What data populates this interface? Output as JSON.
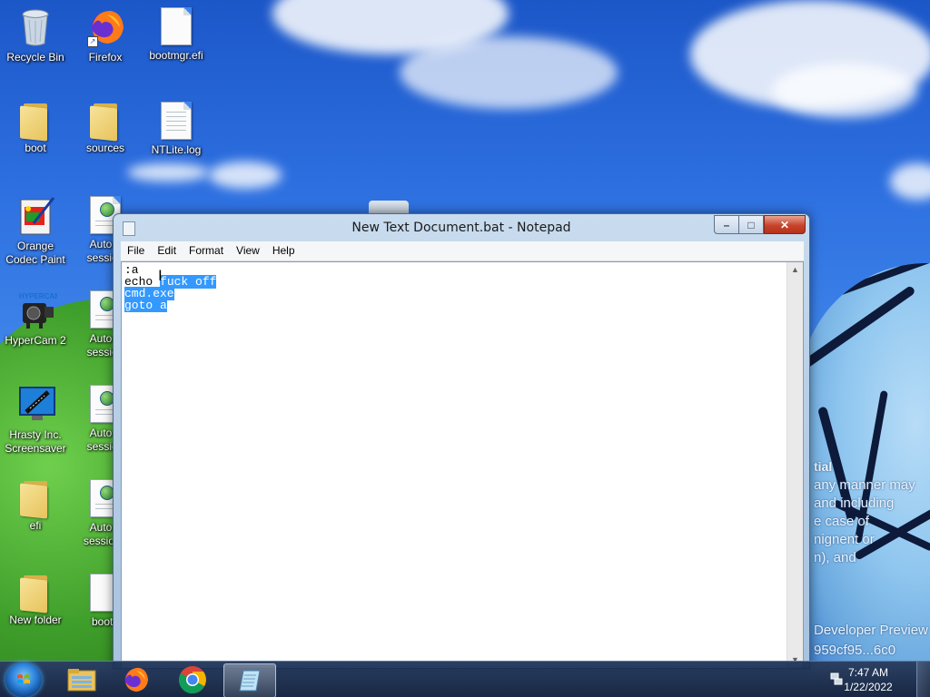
{
  "desktop": {
    "icons": [
      {
        "label": "Recycle Bin",
        "icon": "recycle-bin-icon"
      },
      {
        "label": "Firefox",
        "icon": "firefox-icon"
      },
      {
        "label": "bootmgr.efi",
        "icon": "file-icon"
      },
      {
        "label": "boot",
        "icon": "folder-icon"
      },
      {
        "label": "sources",
        "icon": "folder-icon"
      },
      {
        "label": "NTLite.log",
        "icon": "text-file-icon"
      },
      {
        "label": "Orange\nCodec Paint",
        "icon": "orange-codec-paint-icon"
      },
      {
        "label": "Auto-s\nsession",
        "icon": "session-file-icon"
      },
      {
        "label": "HyperCam 2",
        "icon": "hypercam-icon"
      },
      {
        "label": "Auto-s\nsession",
        "icon": "session-file-icon"
      },
      {
        "label": "Hrasty Inc.\nScreensaver",
        "icon": "screensaver-icon"
      },
      {
        "label": "Auto-s\nsession",
        "icon": "session-file-icon"
      },
      {
        "label": "efi",
        "icon": "folder-icon"
      },
      {
        "label": "Auto-s\nsession (",
        "icon": "session-file-icon"
      },
      {
        "label": "New folder",
        "icon": "folder-icon"
      },
      {
        "label": "bootn",
        "icon": "file-icon"
      }
    ],
    "watermark": {
      "line1": "tial",
      "line2": "any manner may",
      "line3": "and including",
      "line4": "e case of",
      "line5": "nignent or",
      "line6": "n), and",
      "line7": "Developer Preview",
      "line8": "959cf95...6c0"
    }
  },
  "notepad": {
    "title": "New Text Document.bat - Notepad",
    "menus": [
      "File",
      "Edit",
      "Format",
      "View",
      "Help"
    ],
    "lines": [
      {
        "plain": ":a",
        "selected": ""
      },
      {
        "plain": "echo ",
        "selected": "fuck off"
      },
      {
        "plain": "",
        "selected": "cmd.exe"
      },
      {
        "plain": "",
        "selected": "goto a"
      }
    ],
    "buttons": {
      "minimize": "–",
      "maximize": "□",
      "close": "✕"
    }
  },
  "taskbar": {
    "apps": [
      "file-explorer-icon",
      "firefox-icon",
      "chrome-icon",
      "notepad-icon"
    ],
    "clock": {
      "time": "7:47 AM",
      "date": "1/22/2022"
    }
  },
  "colors": {
    "selection": "#3399ff",
    "taskbar": "#16294a",
    "sky": "#2d6fe0"
  }
}
